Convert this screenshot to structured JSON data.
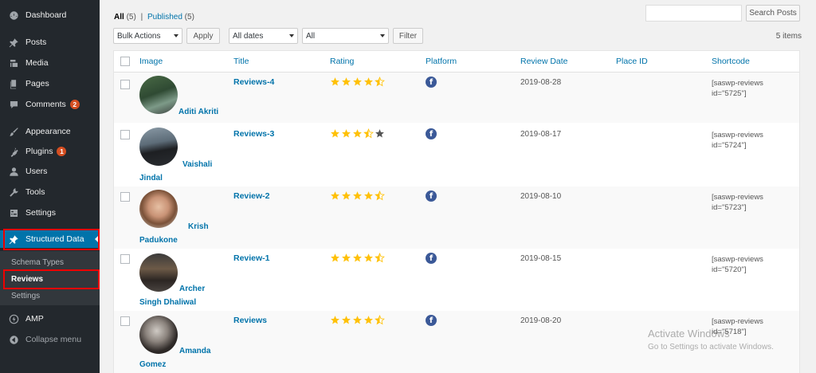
{
  "sidebar": {
    "items": [
      {
        "label": "Dashboard",
        "icon": "dashboard-icon"
      },
      {
        "label": "Posts",
        "icon": "pin-icon"
      },
      {
        "label": "Media",
        "icon": "media-icon"
      },
      {
        "label": "Pages",
        "icon": "pages-icon"
      },
      {
        "label": "Comments",
        "icon": "comment-icon",
        "badge": "2"
      },
      {
        "label": "Appearance",
        "icon": "brush-icon"
      },
      {
        "label": "Plugins",
        "icon": "plugin-icon",
        "badge": "1"
      },
      {
        "label": "Users",
        "icon": "user-icon"
      },
      {
        "label": "Tools",
        "icon": "wrench-icon"
      },
      {
        "label": "Settings",
        "icon": "settings-icon"
      },
      {
        "label": "Structured Data",
        "icon": "pin-icon"
      },
      {
        "label": "AMP",
        "icon": "amp-icon"
      },
      {
        "label": "Collapse menu",
        "icon": "collapse-icon"
      }
    ],
    "submenu": [
      "Schema Types",
      "Reviews",
      "Settings"
    ]
  },
  "filters": {
    "all_label": "All",
    "all_count": "(5)",
    "separator": "|",
    "published_label": "Published",
    "published_count": "(5)",
    "bulk_actions": "Bulk Actions",
    "apply": "Apply",
    "dates": "All dates",
    "all": "All",
    "filter": "Filter",
    "items_count": "5 items",
    "search_button": "Search Posts"
  },
  "table": {
    "headers": [
      "Image",
      "Title",
      "Rating",
      "Platform",
      "Review Date",
      "Place ID",
      "Shortcode"
    ],
    "rows": [
      {
        "name_line1": "Aditi Akriti",
        "name_line2": "",
        "title": "Reviews-4",
        "rating": 4.5,
        "platform": "f",
        "date": "2019-08-28",
        "sc1": "[saswp-reviews",
        "sc2": "id=\"5725\"]"
      },
      {
        "name_line1": "Vaishali",
        "name_line2": "Jindal",
        "title": "Reviews-3",
        "rating": 3.5,
        "platform": "f",
        "date": "2019-08-17",
        "sc1": "[saswp-reviews",
        "sc2": "id=\"5724\"]"
      },
      {
        "name_line1": "Krish",
        "name_line2": "Padukone",
        "title": "Review-2",
        "rating": 4.5,
        "platform": "f",
        "date": "2019-08-10",
        "sc1": "[saswp-reviews",
        "sc2": "id=\"5723\"]"
      },
      {
        "name_line1": "Archer",
        "name_line2": "Singh Dhaliwal",
        "title": "Review-1",
        "rating": 4.5,
        "platform": "f",
        "date": "2019-08-15",
        "sc1": "[saswp-reviews",
        "sc2": "id=\"5720\"]"
      },
      {
        "name_line1": "Amanda",
        "name_line2": "Gomez",
        "title": "Reviews",
        "rating": 4.5,
        "platform": "f",
        "date": "2019-08-20",
        "sc1": "[saswp-reviews",
        "sc2": "id=\"5718\"]"
      }
    ]
  },
  "watermark": {
    "line1": "Activate Windows",
    "line2": "Go to Settings to activate Windows."
  },
  "colors": {
    "sidebar_bg": "#23282d",
    "accent": "#0073aa",
    "star": "#ffc107",
    "highlight": "#e00000"
  }
}
